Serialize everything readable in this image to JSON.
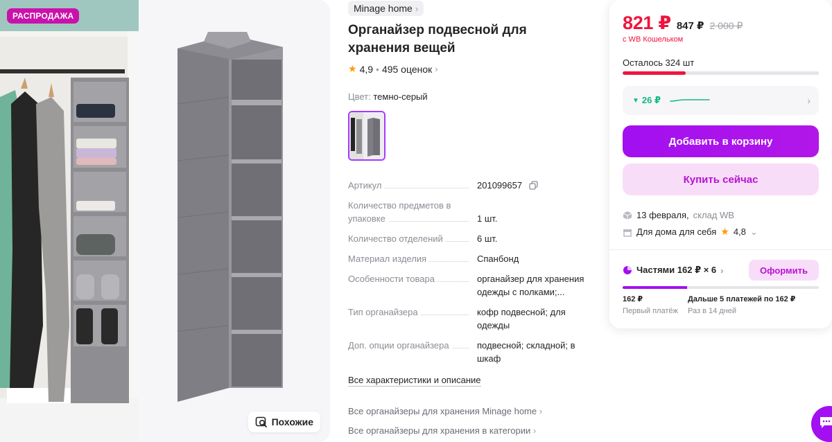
{
  "gallery": {
    "badge": "РАСПРОДАЖА",
    "similar_label": "Похожие"
  },
  "product": {
    "brand": "Minage home",
    "title": "Органайзер подвесной для хранения вещей",
    "rating": "4,9",
    "reviews": "495 оценок",
    "color_label": "Цвет:",
    "color_value": "темно-серый"
  },
  "specs": [
    {
      "key": "Артикул",
      "value": "201099657"
    },
    {
      "key": "Количество предметов в упаковке",
      "value": "1 шт."
    },
    {
      "key": "Количество отделений",
      "value": "6 шт."
    },
    {
      "key": "Материал изделия",
      "value": "Спанбонд"
    },
    {
      "key": "Особенности товара",
      "value": "органайзер для хранения одежды с полками;..."
    },
    {
      "key": "Тип органайзера",
      "value": "кофр подвесной; для одежды"
    },
    {
      "key": "Доп. опции органайзера",
      "value": "подвесной; складной; в шкаф"
    }
  ],
  "links": {
    "all_specs": "Все характеристики и описание",
    "brand_category": "Все органайзеры для хранения Minage home",
    "category": "Все органайзеры для хранения в категории"
  },
  "price_card": {
    "price": "821 ₽",
    "price_no_wallet": "847 ₽",
    "price_old": "2 000 ₽",
    "wallet_note": "с WB Кошельком",
    "stock_text": "Осталось 324 шт",
    "stock_level": 0.32,
    "price_drop": "26 ₽",
    "add_to_cart": "Добавить в корзину",
    "buy_now": "Купить сейчас",
    "delivery_date": "13 февраля,",
    "delivery_warehouse": "склад WB",
    "seller_name": "Для дома для себя",
    "seller_rating": "4,8",
    "installments_title": "Частями 162 ₽ × 6",
    "order_button": "Оформить",
    "installments_progress": 0.33,
    "first_payment_amount": "162 ₽",
    "first_payment_label": "Первый платёж",
    "next_payments_amount": "Дальше 5 платежей по 162 ₽",
    "next_payments_label": "Раз в 14 дней"
  },
  "colors": {
    "accent": "#a20ff0",
    "price_red": "#f0133c",
    "badge": "#cb11ab",
    "drop_green": "#10b981"
  },
  "icons": [
    "search-similar-icon",
    "chevron-right-icon",
    "star-icon",
    "copy-icon",
    "arrow-down-icon",
    "box-icon",
    "shop-icon",
    "pie-chart-icon",
    "chat-icon"
  ]
}
